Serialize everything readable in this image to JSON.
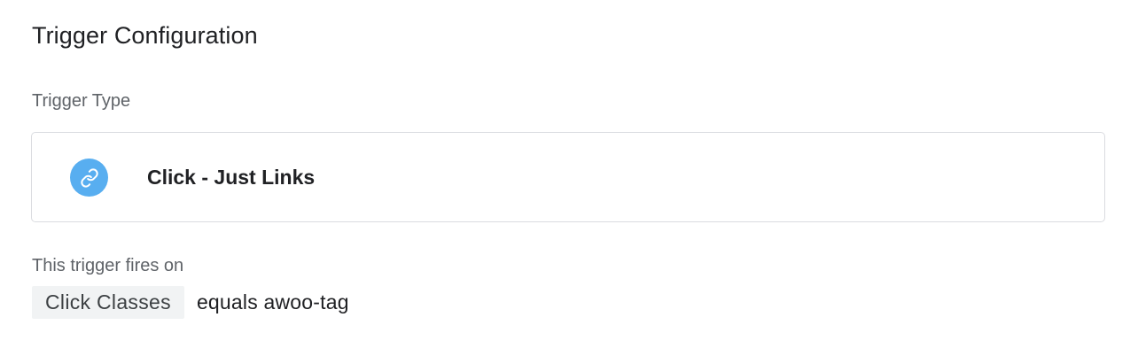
{
  "section": {
    "title": "Trigger Configuration"
  },
  "trigger_type": {
    "label": "Trigger Type",
    "name": "Click - Just Links",
    "icon": "link-icon",
    "icon_bg": "#58aef0"
  },
  "firing": {
    "label": "This trigger fires on",
    "variable": "Click Classes",
    "operator_value": "equals awoo-tag"
  }
}
